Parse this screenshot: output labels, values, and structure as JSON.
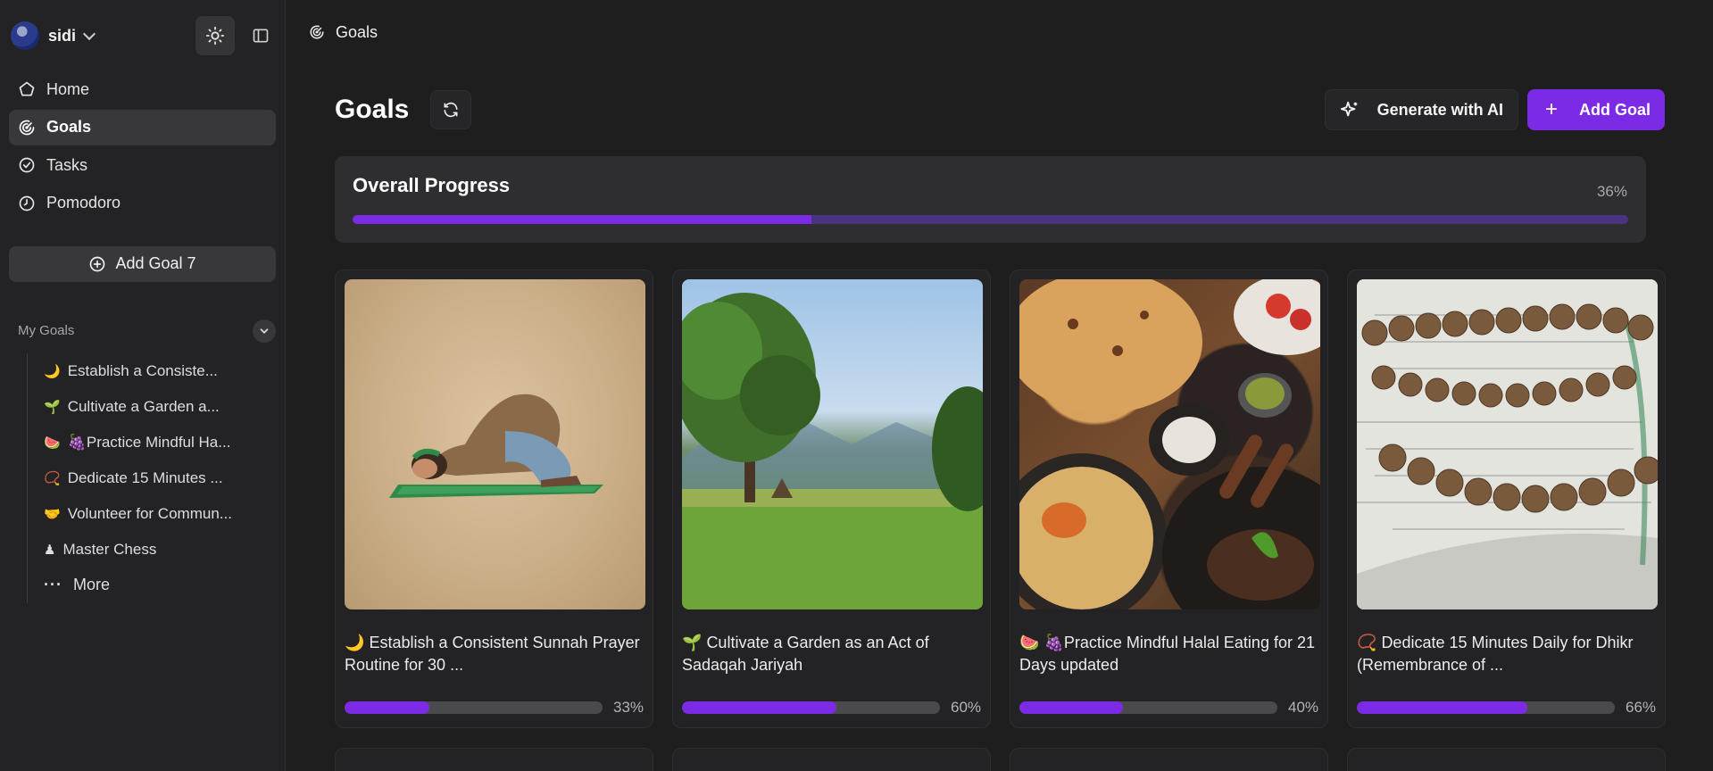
{
  "sidebar": {
    "user_name": "sidi",
    "nav": [
      {
        "label": "Home",
        "icon": "home-icon"
      },
      {
        "label": "Goals",
        "icon": "goals-icon",
        "active": true
      },
      {
        "label": "Tasks",
        "icon": "check-circle-icon"
      },
      {
        "label": "Pomodoro",
        "icon": "clock-icon"
      }
    ],
    "add_goal_label": "Add Goal 7",
    "my_goals_title": "My Goals",
    "goals": [
      {
        "emoji": "🌙",
        "label": "Establish a Consiste..."
      },
      {
        "emoji": "🌱",
        "label": "Cultivate a Garden a..."
      },
      {
        "emoji": "🍉",
        "label": "🍇Practice Mindful Ha..."
      },
      {
        "emoji": "📿",
        "label": "Dedicate 15 Minutes ..."
      },
      {
        "emoji": "🤝",
        "label": "Volunteer for Commun..."
      },
      {
        "emoji": "♟",
        "label": "Master Chess"
      }
    ],
    "more_label": "More"
  },
  "topbar": {
    "title": "Goals"
  },
  "header": {
    "title": "Goals",
    "ai_button": "Generate with AI",
    "add_button": "Add Goal"
  },
  "overall": {
    "title": "Overall Progress",
    "percent_label": "36%",
    "percent": 36
  },
  "cards": [
    {
      "emoji": "🌙",
      "title": "Establish a Consistent Sunnah Prayer Routine for 30 ...",
      "percent_label": "33%",
      "percent": 33,
      "image": "prayer"
    },
    {
      "emoji": "🌱",
      "title": "Cultivate a Garden as an Act of Sadaqah Jariyah",
      "percent_label": "60%",
      "percent": 60,
      "image": "garden"
    },
    {
      "emoji": "🍉",
      "title": "🍇Practice Mindful Halal Eating for 21 Days updated",
      "percent_label": "40%",
      "percent": 40,
      "image": "food"
    },
    {
      "emoji": "📿",
      "title": "Dedicate 15 Minutes Daily for Dhikr (Remembrance of ...",
      "percent_label": "66%",
      "percent": 66,
      "image": "quran"
    }
  ],
  "colors": {
    "accent": "#7b2be6",
    "background": "#1e1e1f",
    "sidebar": "#232325"
  }
}
